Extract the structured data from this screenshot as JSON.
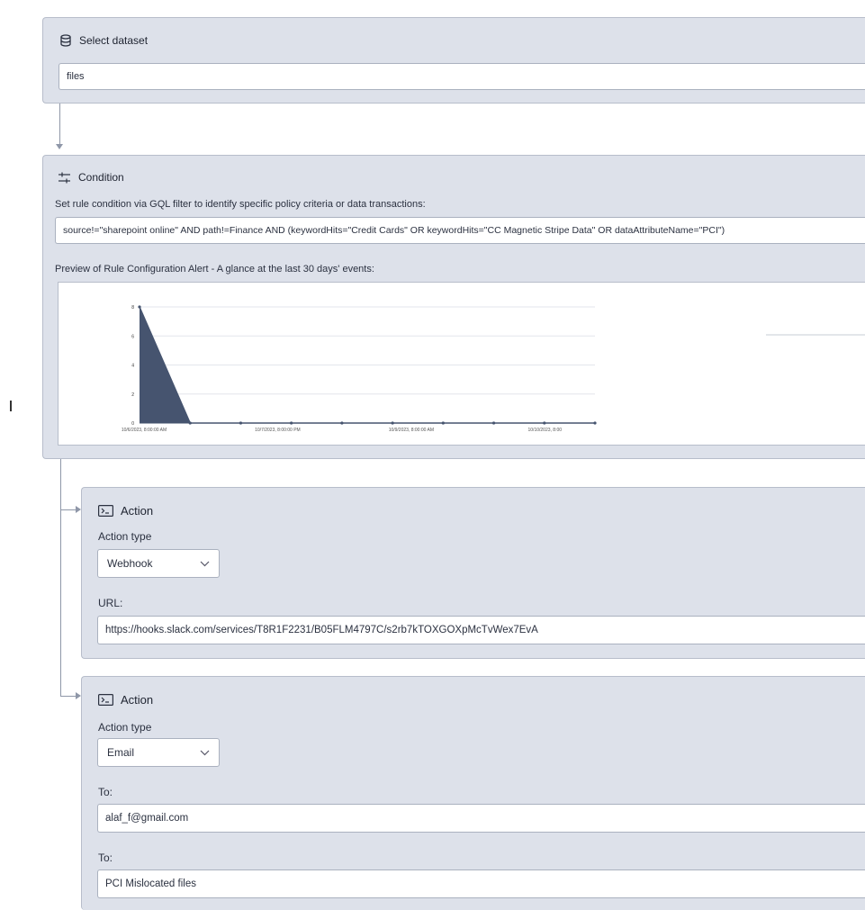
{
  "dataset": {
    "title": "Select dataset",
    "value": "files"
  },
  "condition": {
    "title": "Condition",
    "description": "Set rule condition via GQL filter to identify specific policy criteria or data transactions:",
    "query": "source!=\"sharepoint online\" AND path!=Finance AND (keywordHits=\"Credit Cards\" OR keywordHits=\"CC Magnetic Stripe Data\" OR dataAttributeName=\"PCI\")",
    "preview_label": "Preview of Rule Configuration Alert - A glance at the last 30 days' events:"
  },
  "chart_data": {
    "type": "area",
    "title": "",
    "xlabel": "",
    "ylabel": "",
    "x_tick_labels": [
      "10/6/2023, 8:00:00 AM",
      "10/7/2023, 8:00:00 PM",
      "10/9/2023, 8:00:00 AM",
      "10/10/2023, 8:00"
    ],
    "y_ticks": [
      "0",
      "2",
      "4",
      "6",
      "8"
    ],
    "ylim": [
      0,
      8
    ],
    "x": [
      0,
      1,
      2,
      3,
      4,
      5,
      6,
      7,
      8,
      9
    ],
    "values": [
      8,
      0,
      0,
      0,
      0,
      0,
      0,
      0,
      0,
      0
    ],
    "grid": true,
    "color": "#46546f"
  },
  "action1": {
    "title": "Action",
    "type_label": "Action type",
    "type_value": "Webhook",
    "url_label": "URL:",
    "url_value": "https://hooks.slack.com/services/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"
  },
  "action2": {
    "title": "Action",
    "type_label": "Action type",
    "type_value": "Email",
    "to_label": "To:",
    "to_value": "alaf_f@gmail.com",
    "subject_label": "To:",
    "subject_value": "PCI Mislocated files"
  },
  "icons": {
    "dataset": "database-icon",
    "condition": "sliders-icon",
    "action": "terminal-icon",
    "dropdown": "chevron-down-icon"
  },
  "colors": {
    "panel_bg": "#dde1ea",
    "connector": "#8f97a8",
    "chart_fill": "#46546f"
  }
}
